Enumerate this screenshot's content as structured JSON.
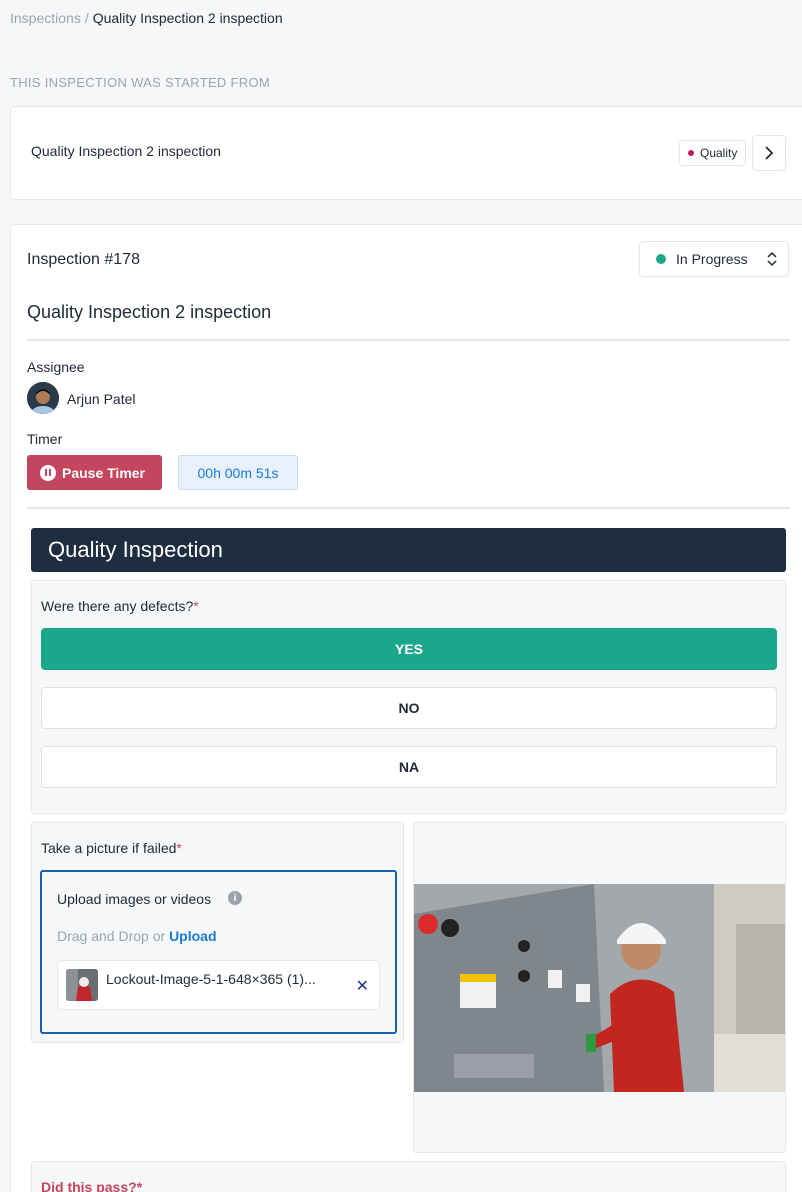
{
  "breadcrumb": {
    "root": "Inspections",
    "separator": "/",
    "current": "Quality Inspection 2 inspection"
  },
  "source": {
    "section_label": "THIS INSPECTION WAS STARTED FROM",
    "title": "Quality Inspection 2 inspection",
    "tag": "Quality",
    "tag_color": "#c2185b"
  },
  "inspection": {
    "number": "Inspection #178",
    "status": "In Progress",
    "status_color": "#1ba78b",
    "title": "Quality Inspection 2 inspection",
    "assignee_label": "Assignee",
    "assignee_name": "Arjun Patel",
    "timer_label": "Timer",
    "pause_label": "Pause Timer",
    "timer_value": "00h 00m 51s"
  },
  "form": {
    "section_title": "Quality Inspection",
    "q1": {
      "label": "Were there any defects?",
      "required": "*",
      "options": [
        "YES",
        "NO",
        "NA"
      ],
      "selected": "YES"
    },
    "q2": {
      "label": "Take a picture if failed",
      "required": "*",
      "upload_title": "Upload images or videos",
      "upload_hint": "Drag and Drop or",
      "upload_link": "Upload",
      "file_name": "Lockout-Image-5-1-648×365 (1)..."
    },
    "q3": {
      "label": "Did this pass?",
      "required": "*"
    }
  },
  "colors": {
    "accent": "#1ba78b",
    "danger": "#c3455e",
    "banner": "#1e2d40",
    "link": "#1a7ad4"
  }
}
